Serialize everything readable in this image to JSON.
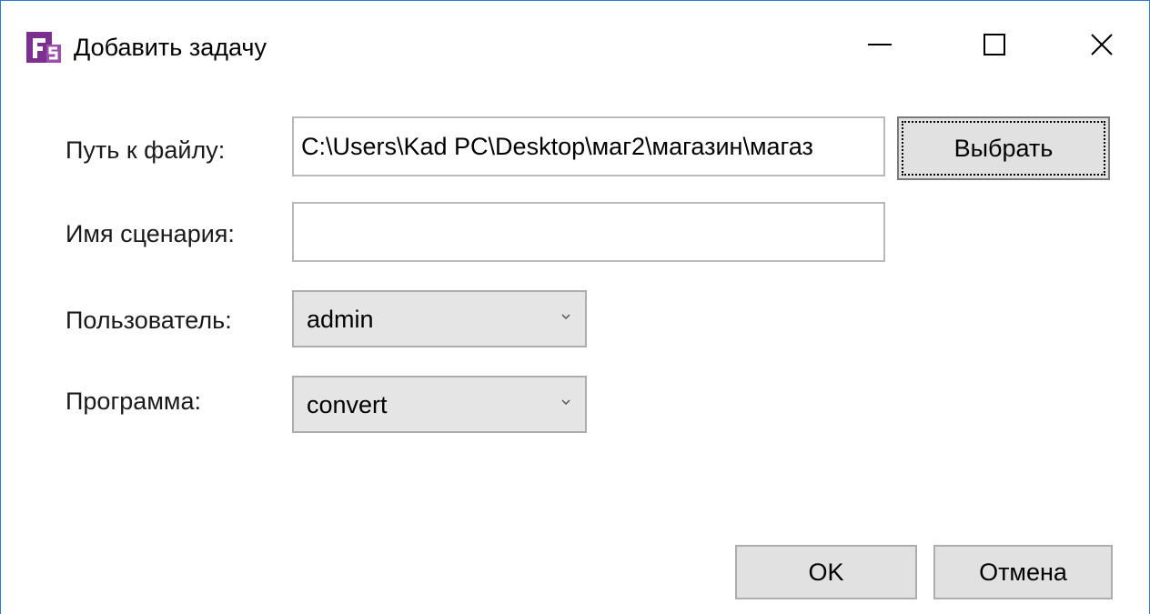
{
  "window": {
    "title": "Добавить задачу",
    "icon": "app-logo-icon",
    "controls": {
      "minimize": "minimize-icon",
      "maximize": "maximize-icon",
      "close": "close-icon"
    }
  },
  "form": {
    "path_label": "Путь к файлу:",
    "path_value": "C:\\Users\\Kad PC\\Desktop\\маг2\\магазин\\магаз",
    "browse_label": "Выбрать",
    "name_label": "Имя сценария:",
    "name_value": "",
    "user_label": "Пользователь:",
    "user_value": "admin",
    "program_label": "Программа:",
    "program_value": "convert"
  },
  "buttons": {
    "ok": "OK",
    "cancel": "Отмена"
  },
  "colors": {
    "window_border": "#2b79d0",
    "icon_purple": "#7b2f8e",
    "button_bg": "#e1e1e1"
  }
}
